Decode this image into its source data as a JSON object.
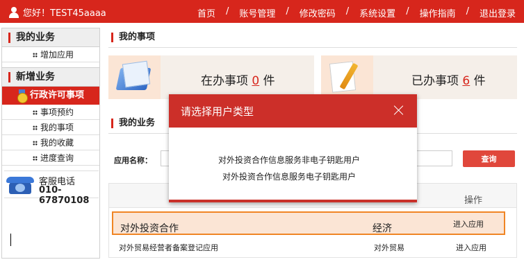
{
  "header": {
    "greeting": "您好！TEST45aaaa",
    "nav": [
      "首页",
      "账号管理",
      "修改密码",
      "系统设置",
      "操作指南",
      "退出登录"
    ],
    "separator": "/",
    "user_icon": "user-icon"
  },
  "sidebar": {
    "section1_title": "我的业务",
    "section1_items": [
      "增加应用"
    ],
    "section2_title": "新增业务",
    "active_item": "行政许可事项",
    "section2_items": [
      "事项预约",
      "我的事项",
      "我的收藏",
      "进度查询"
    ],
    "hotline_title": "客服电话",
    "hotline_number": "010-67870108"
  },
  "main": {
    "my_items_title": "我的事项",
    "pending": {
      "prefix": "在办事项",
      "count": "0",
      "suffix": "件"
    },
    "done": {
      "prefix": "已办事项",
      "count": "6",
      "suffix": "件"
    },
    "my_business_title": "我的业务",
    "search": {
      "label": "应用名称：",
      "value": "",
      "button": "查询"
    },
    "table": {
      "col_action": "操作",
      "rows": [
        {
          "name": "对外投资合作",
          "category": "经济",
          "action": "进入应用"
        },
        {
          "name": "对外贸易经营者备案登记应用",
          "category": "对外贸易",
          "action": "进入应用"
        }
      ]
    }
  },
  "modal": {
    "title": "请选择用户类型",
    "options": [
      "对外投资合作信息服务非电子钥匙用户",
      "对外投资合作信息服务电子钥匙用户"
    ]
  },
  "colors": {
    "brand_red": "#d7261c",
    "highlight_border": "#f08524",
    "highlight_bg": "#fbe5d5"
  }
}
